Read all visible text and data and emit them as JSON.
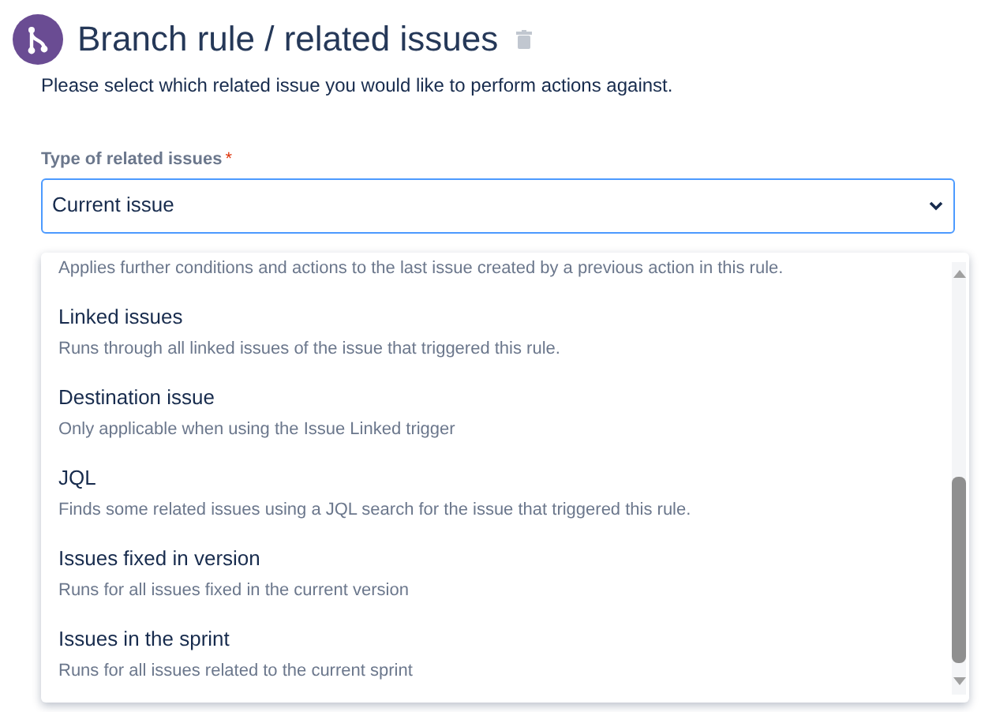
{
  "header": {
    "title": "Branch rule / related issues",
    "subtitle": "Please select which related issue you would like to perform actions against."
  },
  "field": {
    "label": "Type of related issues",
    "required_mark": "*",
    "value": "Current issue"
  },
  "dropdown": {
    "options": [
      {
        "description": "Applies further conditions and actions to the last issue created by a previous action in this rule."
      },
      {
        "title": "Linked issues",
        "description": "Runs through all linked issues of the issue that triggered this rule."
      },
      {
        "title": "Destination issue",
        "description": "Only applicable when using the Issue Linked trigger"
      },
      {
        "title": "JQL",
        "description": "Finds some related issues using a JQL search for the issue that triggered this rule."
      },
      {
        "title": "Issues fixed in version",
        "description": "Runs for all issues fixed in the current version"
      },
      {
        "title": "Issues in the sprint",
        "description": "Runs for all issues related to the current sprint"
      }
    ]
  }
}
